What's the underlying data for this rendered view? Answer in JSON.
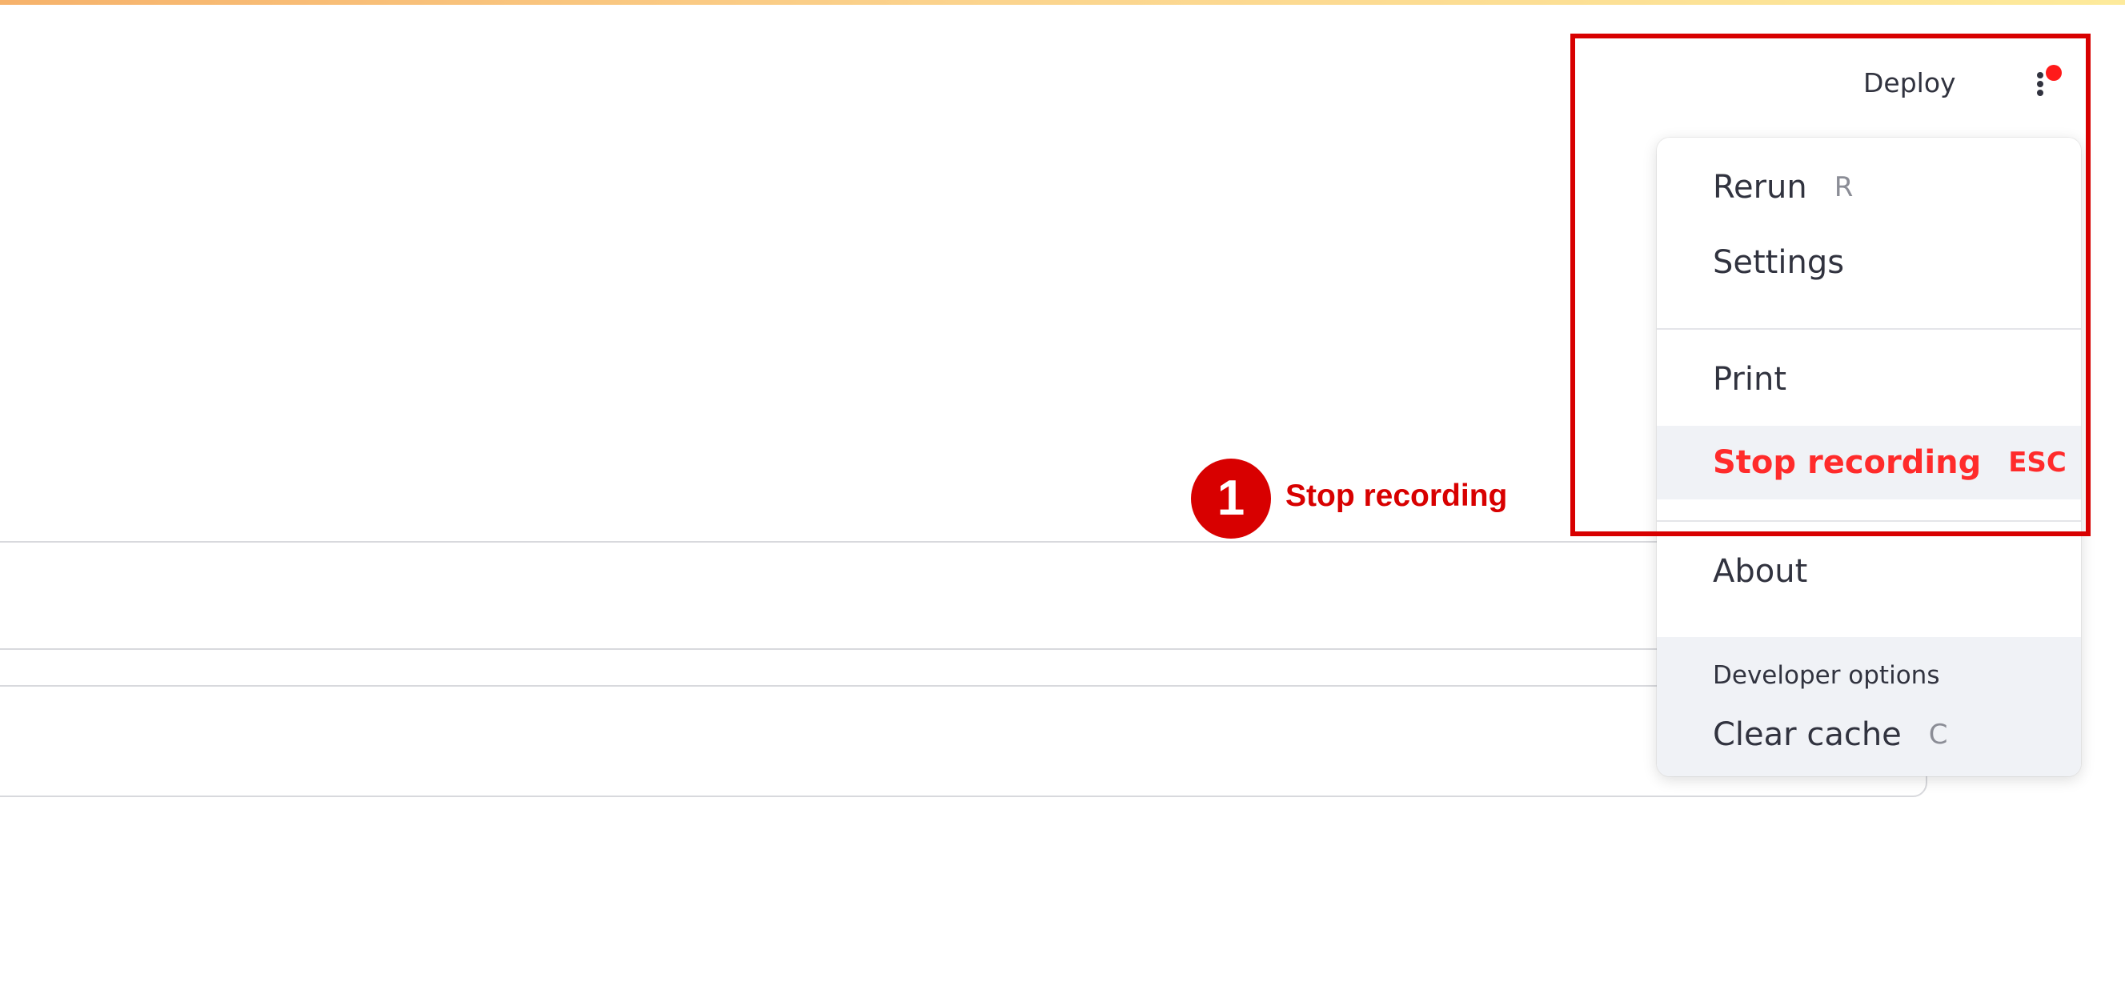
{
  "header": {
    "deploy_label": "Deploy",
    "menu_icon": "vertical-dots-icon",
    "status_dot_color": "#ff1a1a"
  },
  "menu": {
    "items": [
      {
        "label": "Rerun",
        "shortcut": "R"
      },
      {
        "label": "Settings"
      },
      {
        "label": "Print"
      },
      {
        "label": "Stop recording",
        "shortcut": "ESC",
        "active": true,
        "color": "#ff2b2b"
      },
      {
        "label": "About"
      }
    ],
    "developer": {
      "heading": "Developer options",
      "items": [
        {
          "label": "Clear cache",
          "shortcut": "C"
        }
      ]
    }
  },
  "annotation": {
    "step_number": "1",
    "step_label": "Stop recording",
    "color": "#d80000"
  }
}
